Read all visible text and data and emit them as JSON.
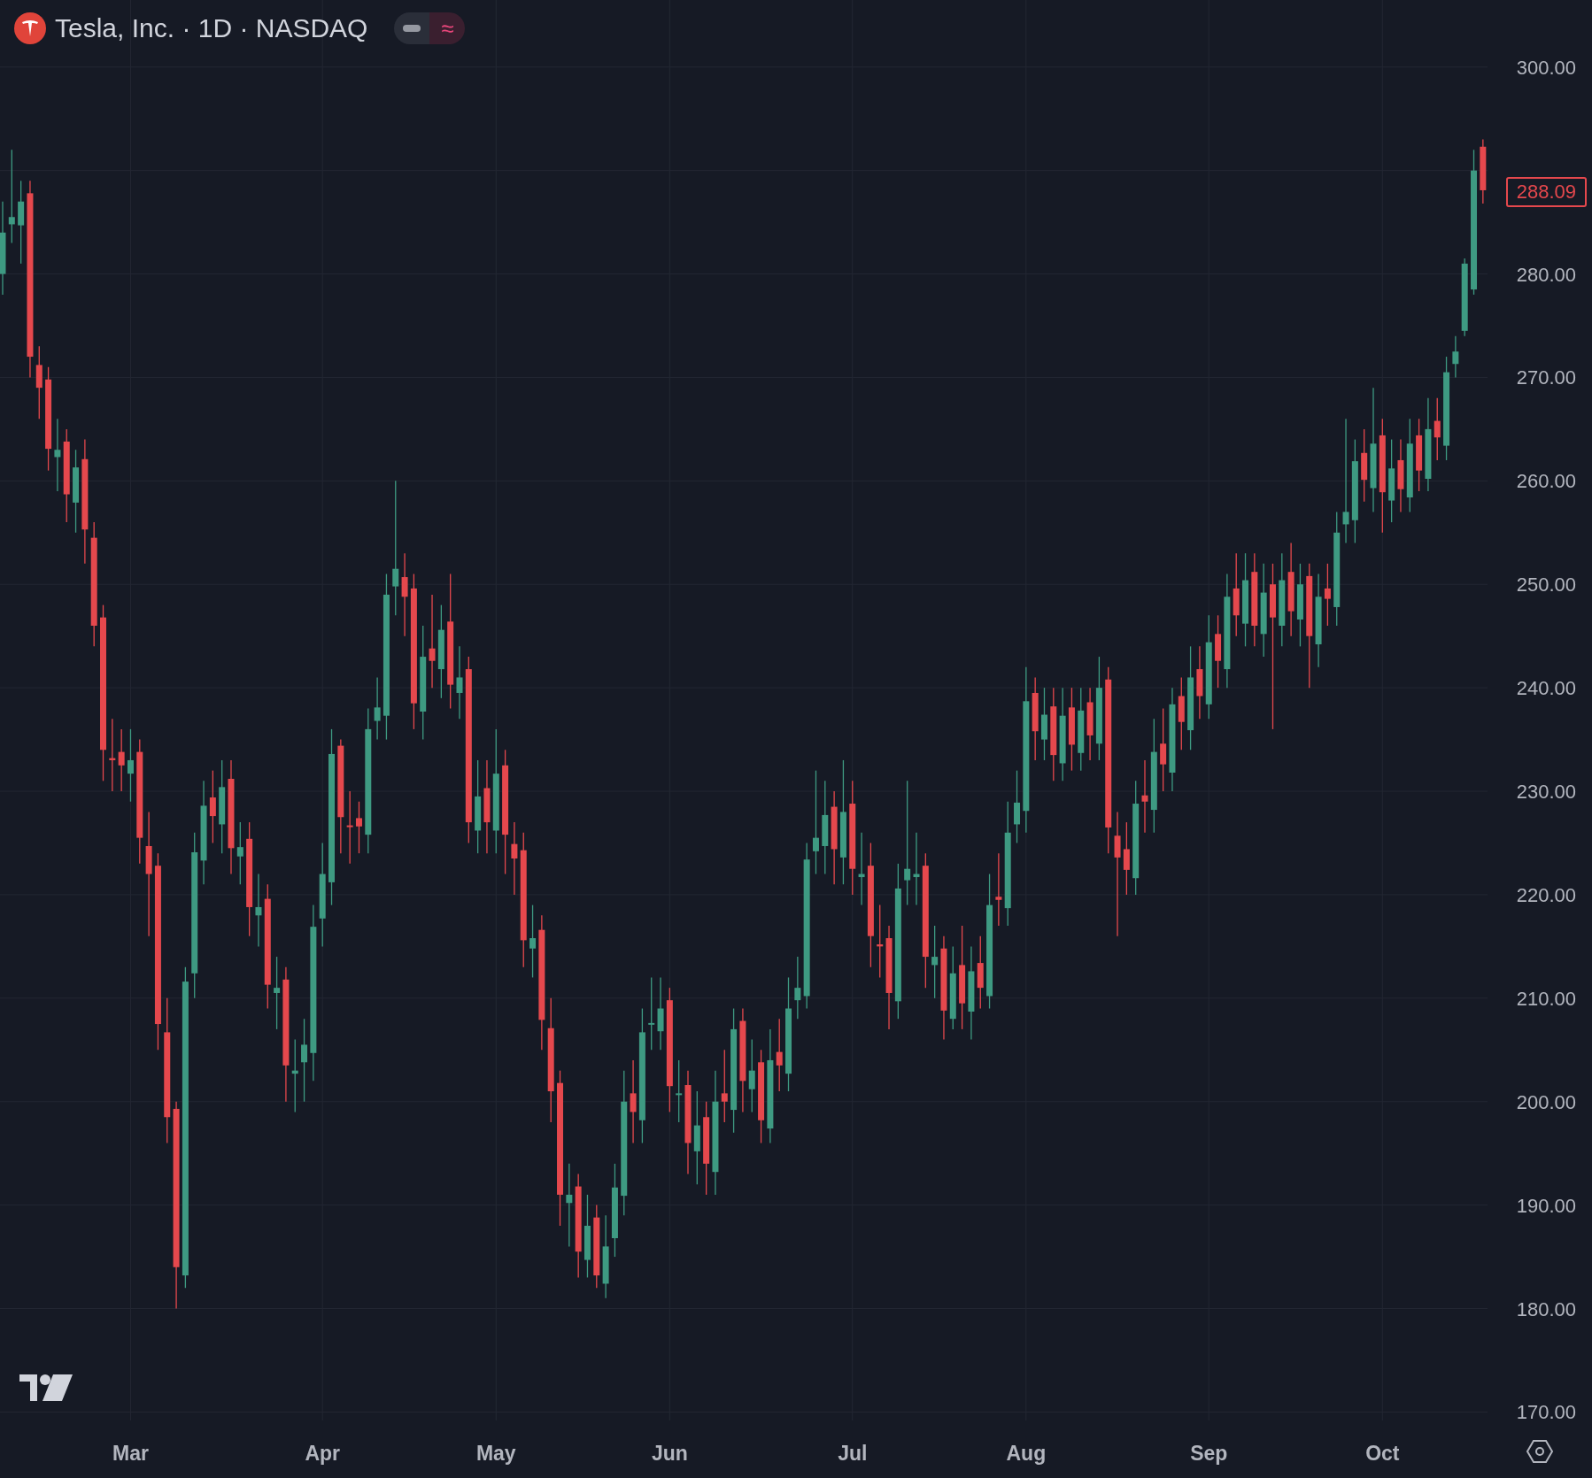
{
  "header": {
    "title": "Tesla, Inc. · 1D · NASDAQ",
    "wave_symbol": "≈"
  },
  "chart": {
    "last_price": "288.09",
    "chart_data": {
      "type": "candlestick",
      "grid": true,
      "ylim": [
        169.18,
        306.48
      ],
      "categories": [
        null,
        null,
        null,
        null,
        null,
        null,
        null,
        null,
        null,
        null,
        null,
        null,
        null,
        null,
        "Mar",
        null,
        null,
        null,
        null,
        null,
        null,
        null,
        null,
        null,
        null,
        null,
        null,
        null,
        null,
        null,
        null,
        null,
        null,
        null,
        null,
        "Apr",
        null,
        null,
        null,
        null,
        null,
        null,
        null,
        null,
        null,
        null,
        null,
        null,
        null,
        null,
        null,
        null,
        null,
        null,
        "May",
        null,
        null,
        null,
        null,
        null,
        null,
        null,
        null,
        null,
        null,
        null,
        null,
        null,
        null,
        null,
        null,
        null,
        null,
        "Jun",
        null,
        null,
        null,
        null,
        null,
        null,
        null,
        null,
        null,
        null,
        null,
        null,
        null,
        null,
        null,
        null,
        null,
        null,
        null,
        "Jul",
        null,
        null,
        null,
        null,
        null,
        null,
        null,
        null,
        null,
        null,
        null,
        null,
        null,
        null,
        null,
        null,
        null,
        null,
        "Aug",
        null,
        null,
        null,
        null,
        null,
        null,
        null,
        null,
        null,
        null,
        null,
        null,
        null,
        null,
        null,
        null,
        null,
        null,
        null,
        "Sep",
        null,
        null,
        null,
        null,
        null,
        null,
        null,
        null,
        null,
        null,
        null,
        null,
        null,
        null,
        null,
        null,
        null,
        null,
        "Oct",
        null,
        null,
        null,
        null,
        null,
        null,
        null,
        null,
        null,
        null,
        null
      ],
      "yticks": [
        {
          "value": 300,
          "label": "300.00"
        },
        {
          "value": 280,
          "label": "280.00"
        },
        {
          "value": 270,
          "label": "270.00"
        },
        {
          "value": 260,
          "label": "260.00"
        },
        {
          "value": 250,
          "label": "250.00"
        },
        {
          "value": 240,
          "label": "240.00"
        },
        {
          "value": 230,
          "label": "230.00"
        },
        {
          "value": 220,
          "label": "220.00"
        },
        {
          "value": 210,
          "label": "210.00"
        },
        {
          "value": 200,
          "label": "200.00"
        },
        {
          "value": 190,
          "label": "190.00"
        },
        {
          "value": 180,
          "label": "180.00"
        },
        {
          "value": 170,
          "label": "170.00"
        }
      ],
      "ohlc": [
        [
          280,
          287,
          278,
          284
        ],
        [
          284.8,
          292,
          283,
          285.5
        ],
        [
          284.7,
          289,
          281,
          287
        ],
        [
          287.8,
          289,
          270,
          272
        ],
        [
          271.2,
          273,
          266,
          269
        ],
        [
          269.8,
          271,
          261,
          263.1
        ],
        [
          262.3,
          266,
          259,
          263
        ],
        [
          263.8,
          265,
          256,
          258.7
        ],
        [
          257.9,
          263,
          255,
          261.3
        ],
        [
          262.1,
          264,
          252,
          255.3
        ],
        [
          254.5,
          256,
          244,
          246
        ],
        [
          246.8,
          248,
          231,
          234
        ],
        [
          233.2,
          237,
          230,
          233
        ],
        [
          233.8,
          236,
          230,
          232.5
        ],
        [
          231.7,
          236,
          229,
          233
        ],
        [
          233.8,
          235,
          223,
          225.5
        ],
        [
          224.7,
          228,
          216,
          222
        ],
        [
          222.8,
          224,
          205,
          207.5
        ],
        [
          206.7,
          210,
          196,
          198.5
        ],
        [
          199.3,
          200,
          180,
          184
        ],
        [
          183.2,
          213,
          182,
          211.6
        ],
        [
          212.4,
          226,
          210,
          224.1
        ],
        [
          223.3,
          231,
          221,
          228.6
        ],
        [
          229.4,
          232,
          225,
          227.6
        ],
        [
          226.8,
          233,
          224,
          230.4
        ],
        [
          231.2,
          233,
          222,
          224.5
        ],
        [
          223.7,
          227,
          221,
          224.6
        ],
        [
          225.4,
          227,
          216,
          218.8
        ],
        [
          218,
          222,
          215,
          218.8
        ],
        [
          219.6,
          221,
          209,
          211.3
        ],
        [
          210.5,
          214,
          207,
          211
        ],
        [
          211.8,
          213,
          200,
          203.5
        ],
        [
          202.7,
          206,
          199,
          203
        ],
        [
          203.8,
          208,
          200,
          205.5
        ],
        [
          204.7,
          219,
          202,
          216.9
        ],
        [
          217.7,
          225,
          215,
          222
        ],
        [
          221.2,
          236,
          219,
          233.6
        ],
        [
          234.4,
          235,
          224,
          227.5
        ],
        [
          226.7,
          230,
          223,
          226.6
        ],
        [
          227.4,
          229,
          224,
          226.6
        ],
        [
          225.8,
          238,
          224,
          236
        ],
        [
          236.8,
          241,
          235,
          238.1
        ],
        [
          237.3,
          251,
          235,
          249
        ],
        [
          249.8,
          260,
          247,
          251.5
        ],
        [
          250.7,
          253,
          245,
          248.8
        ],
        [
          249.6,
          251,
          236,
          238.5
        ],
        [
          237.7,
          246,
          235,
          243
        ],
        [
          243.8,
          249,
          240,
          242.6
        ],
        [
          241.8,
          248,
          239,
          245.6
        ],
        [
          246.4,
          251,
          238,
          240.3
        ],
        [
          239.5,
          244,
          237,
          241
        ],
        [
          241.8,
          243,
          225,
          227
        ],
        [
          226.2,
          233,
          224,
          229.5
        ],
        [
          230.3,
          233,
          224,
          227
        ],
        [
          226.2,
          236,
          224,
          231.7
        ],
        [
          232.5,
          234,
          222,
          225.8
        ],
        [
          224.9,
          227,
          220,
          223.5
        ],
        [
          224.3,
          226,
          213,
          215.6
        ],
        [
          214.8,
          219,
          212,
          215.8
        ],
        [
          216.6,
          218,
          205,
          207.9
        ],
        [
          207.1,
          210,
          198,
          201
        ],
        [
          201.8,
          203,
          188,
          191
        ],
        [
          190.2,
          194,
          186,
          191
        ],
        [
          191.8,
          193,
          183,
          185.5
        ],
        [
          184.7,
          191,
          183,
          188
        ],
        [
          188.8,
          190,
          182,
          183.2
        ],
        [
          182.4,
          189,
          181,
          186
        ],
        [
          186.8,
          194,
          185,
          191.7
        ],
        [
          190.9,
          203,
          189,
          200
        ],
        [
          200.8,
          204,
          196,
          199
        ],
        [
          198.2,
          209,
          196,
          206.7
        ],
        [
          207.5,
          212,
          205,
          207.6
        ],
        [
          206.8,
          212,
          205,
          209
        ],
        [
          209.8,
          211,
          199,
          201.5
        ],
        [
          200.7,
          204,
          198,
          200.8
        ],
        [
          201.6,
          203,
          193,
          196
        ],
        [
          195.2,
          201,
          192,
          197.7
        ],
        [
          198.5,
          200,
          191,
          194
        ],
        [
          193.2,
          203,
          191,
          200
        ],
        [
          200.8,
          205,
          198,
          200
        ],
        [
          199.2,
          209,
          197,
          207
        ],
        [
          207.8,
          209,
          199,
          202
        ],
        [
          201.2,
          206,
          199,
          203
        ],
        [
          203.8,
          205,
          196,
          198.2
        ],
        [
          197.4,
          207,
          196,
          204
        ],
        [
          204.8,
          208,
          201,
          203.5
        ],
        [
          202.7,
          212,
          201,
          209
        ],
        [
          209.8,
          214,
          208,
          211
        ],
        [
          210.2,
          225,
          209,
          223.4
        ],
        [
          224.2,
          232,
          222,
          225.5
        ],
        [
          224.7,
          231,
          222,
          227.7
        ],
        [
          228.5,
          230,
          221,
          224.4
        ],
        [
          223.6,
          233,
          221,
          228
        ],
        [
          228.8,
          231,
          220,
          222.5
        ],
        [
          221.7,
          226,
          219,
          222
        ],
        [
          222.8,
          225,
          213,
          216
        ],
        [
          215.2,
          219,
          212,
          215
        ],
        [
          215.8,
          217,
          207,
          210.5
        ],
        [
          209.7,
          223,
          208,
          220.6
        ],
        [
          221.4,
          231,
          219,
          222.5
        ],
        [
          221.7,
          226,
          219,
          222
        ],
        [
          222.8,
          224,
          211,
          214
        ],
        [
          213.2,
          217,
          210,
          214
        ],
        [
          214.8,
          216,
          206,
          208.8
        ],
        [
          208,
          215,
          207,
          212.4
        ],
        [
          213.2,
          217,
          207,
          209.5
        ],
        [
          208.7,
          215,
          206,
          212.6
        ],
        [
          213.4,
          216,
          209,
          211
        ],
        [
          210.2,
          222,
          209,
          219
        ],
        [
          219.8,
          224,
          217,
          219.5
        ],
        [
          218.7,
          229,
          217,
          226
        ],
        [
          226.8,
          232,
          225,
          228.9
        ],
        [
          228.1,
          242,
          226,
          238.7
        ],
        [
          239.5,
          241,
          233,
          235.8
        ],
        [
          235,
          240,
          233,
          237.4
        ],
        [
          238.2,
          240,
          231,
          233.5
        ],
        [
          232.7,
          240,
          231,
          237.3
        ],
        [
          238.1,
          240,
          232,
          234.5
        ],
        [
          233.7,
          240,
          232,
          237.8
        ],
        [
          238.6,
          240,
          233,
          235.4
        ],
        [
          234.6,
          243,
          233,
          240
        ],
        [
          240.8,
          242,
          224,
          226.5
        ],
        [
          225.7,
          228,
          216,
          223.6
        ],
        [
          224.4,
          227,
          220,
          222.4
        ],
        [
          221.6,
          231,
          220,
          228.8
        ],
        [
          229.6,
          233,
          226,
          229
        ],
        [
          228.2,
          237,
          226,
          233.8
        ],
        [
          234.6,
          238,
          230,
          232.6
        ],
        [
          231.8,
          240,
          230,
          238.4
        ],
        [
          239.2,
          241,
          234,
          236.7
        ],
        [
          235.9,
          244,
          234,
          241
        ],
        [
          241.8,
          244,
          237,
          239.2
        ],
        [
          238.4,
          247,
          237,
          244.4
        ],
        [
          245.2,
          247,
          240,
          242.6
        ],
        [
          241.8,
          251,
          240,
          248.8
        ],
        [
          249.6,
          253,
          245,
          247
        ],
        [
          246.2,
          253,
          244,
          250.4
        ],
        [
          251.2,
          253,
          244,
          246
        ],
        [
          245.2,
          252,
          243,
          249.2
        ],
        [
          250,
          252,
          236,
          246.8
        ],
        [
          246,
          253,
          244,
          250.4
        ],
        [
          251.2,
          254,
          245,
          247.4
        ],
        [
          246.6,
          252,
          244,
          250
        ],
        [
          250.8,
          252,
          240,
          245
        ],
        [
          244.2,
          251,
          242,
          248.8
        ],
        [
          249.6,
          252,
          246,
          248.6
        ],
        [
          247.8,
          257,
          246,
          255
        ],
        [
          255.8,
          266,
          254,
          257
        ],
        [
          256.2,
          264,
          254,
          261.9
        ],
        [
          262.7,
          265,
          258,
          260.1
        ],
        [
          259.3,
          269,
          257,
          263.6
        ],
        [
          264.4,
          266,
          255,
          258.9
        ],
        [
          258.1,
          264,
          256,
          261.2
        ],
        [
          262,
          264,
          257,
          259.2
        ],
        [
          258.4,
          266,
          257,
          263.6
        ],
        [
          264.4,
          266,
          259,
          261
        ],
        [
          260.2,
          268,
          259,
          265
        ],
        [
          265.8,
          268,
          262,
          264.2
        ],
        [
          263.4,
          272,
          262,
          270.5
        ],
        [
          271.3,
          274,
          270,
          272.5
        ],
        [
          274.5,
          281.5,
          274,
          281
        ],
        [
          278.5,
          292,
          278,
          290
        ],
        [
          292.3,
          293,
          286.8,
          288.09
        ]
      ]
    }
  }
}
